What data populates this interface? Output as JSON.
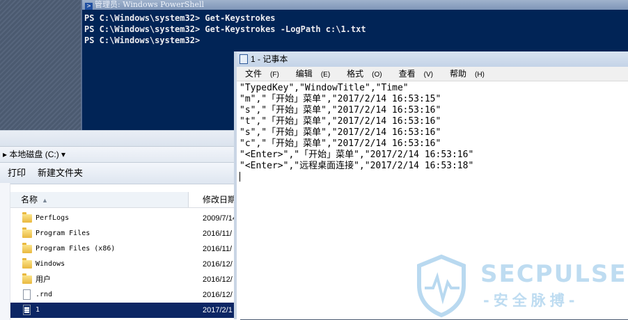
{
  "powershell": {
    "title": "管理员: Windows PowerShell",
    "lines": [
      "PS C:\\Windows\\system32> Get-Keystrokes",
      "PS C:\\Windows\\system32> Get-Keystrokes -LogPath c:\\1.txt",
      "PS C:\\Windows\\system32>"
    ]
  },
  "explorer": {
    "address": "▸ 本地磁盘 (C:) ▾",
    "toolbar": {
      "print": "打印",
      "new_folder": "新建文件夹"
    },
    "columns": {
      "name": "名称",
      "date": "修改日期"
    },
    "files": [
      {
        "name": "PerfLogs",
        "date": "2009/7/14",
        "type": "folder"
      },
      {
        "name": "Program Files",
        "date": "2016/11/",
        "type": "folder"
      },
      {
        "name": "Program Files (x86)",
        "date": "2016/11/",
        "type": "folder"
      },
      {
        "name": "Windows",
        "date": "2016/12/",
        "type": "folder"
      },
      {
        "name": "用户",
        "date": "2016/12/",
        "type": "folder"
      },
      {
        "name": ".rnd",
        "date": "2016/12/",
        "type": "file"
      },
      {
        "name": "1",
        "date": "2017/2/1",
        "type": "text",
        "selected": true
      }
    ]
  },
  "notepad": {
    "title": "1 - 记事本",
    "menu": [
      {
        "label": "文件",
        "key": "(F)"
      },
      {
        "label": "编辑",
        "key": "(E)"
      },
      {
        "label": "格式",
        "key": "(O)"
      },
      {
        "label": "查看",
        "key": "(V)"
      },
      {
        "label": "帮助",
        "key": "(H)"
      }
    ],
    "lines": [
      "\"TypedKey\",\"WindowTitle\",\"Time\"",
      "\"m\",\"「开始」菜单\",\"2017/2/14 16:53:15\"",
      "\"s\",\"「开始」菜单\",\"2017/2/14 16:53:16\"",
      "\"t\",\"「开始」菜单\",\"2017/2/14 16:53:16\"",
      "\"s\",\"「开始」菜单\",\"2017/2/14 16:53:16\"",
      "\"c\",\"「开始」菜单\",\"2017/2/14 16:53:16\"",
      "\"<Enter>\",\"「开始」菜单\",\"2017/2/14 16:53:16\"",
      "\"<Enter>\",\"远程桌面连接\",\"2017/2/14 16:53:18\""
    ]
  },
  "watermark": {
    "title": "SECPULSE",
    "subtitle": "-安全脉搏-"
  }
}
